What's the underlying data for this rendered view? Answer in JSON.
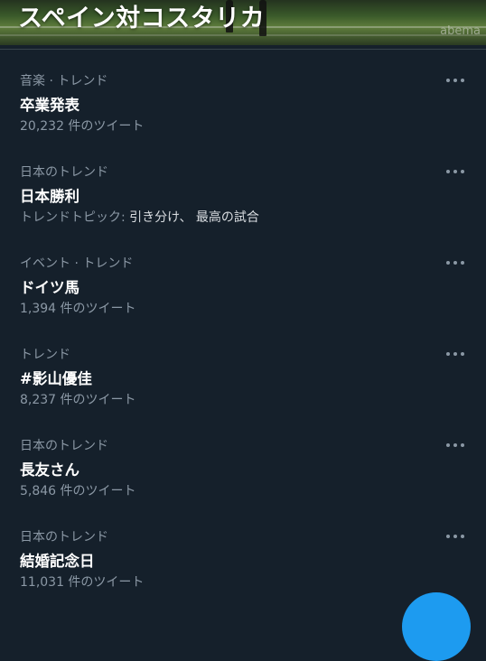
{
  "header": {
    "title": "スペイン対コスタリカ",
    "watermark": "abema"
  },
  "trends": [
    {
      "meta": "音楽 · トレンド",
      "topic": "卒業発表",
      "sub": "20,232 件のツイート"
    },
    {
      "meta": "日本のトレンド",
      "topic": "日本勝利",
      "sub_prefix": "トレンドトピック: ",
      "sub_highlight": "引き分け、 最高の試合"
    },
    {
      "meta": "イベント · トレンド",
      "topic": "ドイツ馬",
      "sub": "1,394 件のツイート"
    },
    {
      "meta": "トレンド",
      "topic": "#影山優佳",
      "sub": "8,237 件のツイート"
    },
    {
      "meta": "日本のトレンド",
      "topic": "長友さん",
      "sub": "5,846 件のツイート"
    },
    {
      "meta": "日本のトレンド",
      "topic": "結婚記念日",
      "sub": "11,031 件のツイート"
    }
  ],
  "colors": {
    "background": "#15202b",
    "secondary_text": "#8b98a5",
    "accent": "#1d9bf0"
  },
  "icons": {
    "more": "more-horizontal-icon",
    "compose": "compose-fab"
  }
}
